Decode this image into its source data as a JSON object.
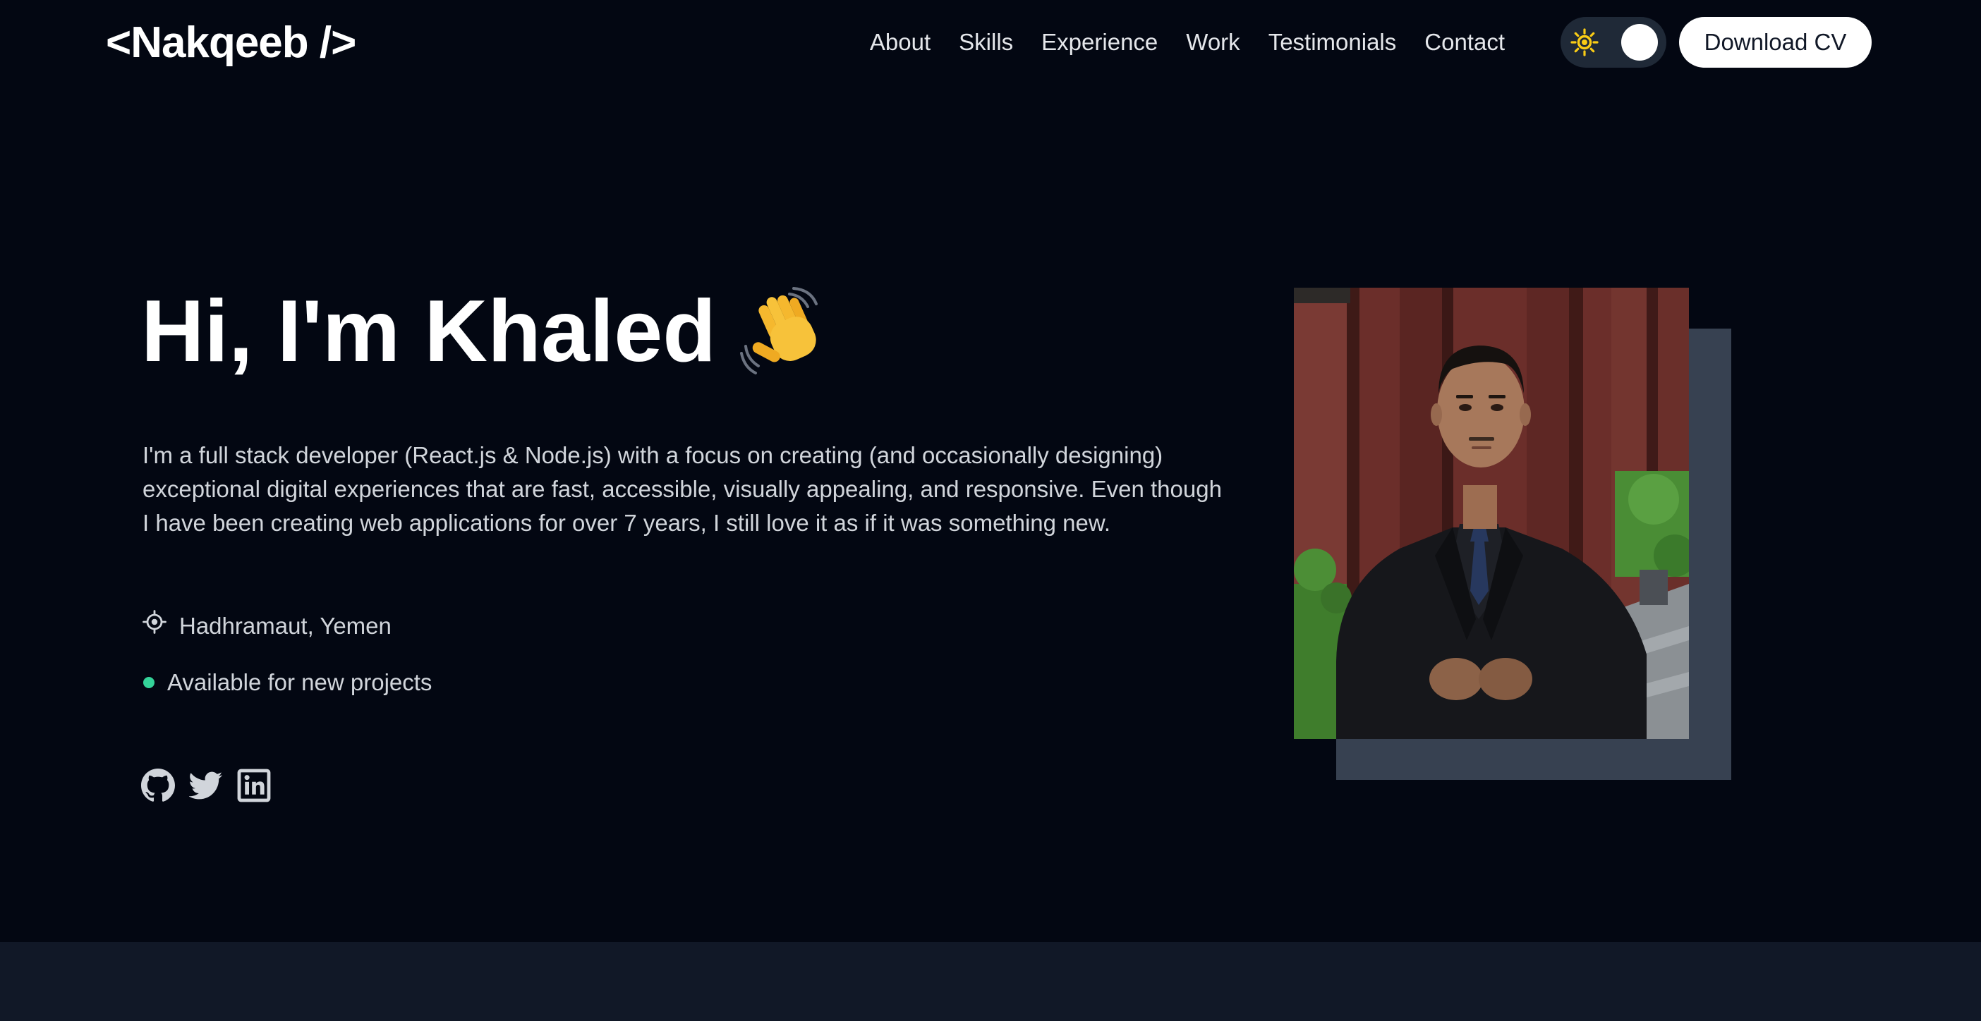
{
  "header": {
    "logo": "<Nakqeeb />",
    "nav": [
      {
        "label": "About"
      },
      {
        "label": "Skills"
      },
      {
        "label": "Experience"
      },
      {
        "label": "Work"
      },
      {
        "label": "Testimonials"
      },
      {
        "label": "Contact"
      }
    ],
    "theme_toggle": {
      "icon": "sun-icon",
      "state": "dark"
    },
    "download_cv_label": "Download CV"
  },
  "hero": {
    "title": "Hi, I'm Khaled",
    "title_icon": "waving-hand-icon",
    "bio": "I'm a full stack developer (React.js & Node.js) with a focus on creating (and occasionally designing) exceptional digital experiences that are fast, accessible, visually appealing, and responsive. Even though I have been creating web applications for over 7 years, I still love it as if it was something new.",
    "location": {
      "icon": "location-icon",
      "text": "Hadhramaut, Yemen"
    },
    "status": {
      "text": "Available for new projects",
      "color": "#34d399"
    },
    "socials": [
      {
        "icon": "github-icon"
      },
      {
        "icon": "twitter-icon"
      },
      {
        "icon": "linkedin-icon"
      }
    ],
    "portrait": {
      "icon": "profile-photo"
    }
  },
  "colors": {
    "background": "#030712",
    "bottom_band": "#111827",
    "portrait_backdrop": "#374151",
    "text_primary": "#ffffff",
    "text_secondary": "#d1d5db",
    "status_green": "#34d399",
    "sun_yellow": "#facc15"
  }
}
